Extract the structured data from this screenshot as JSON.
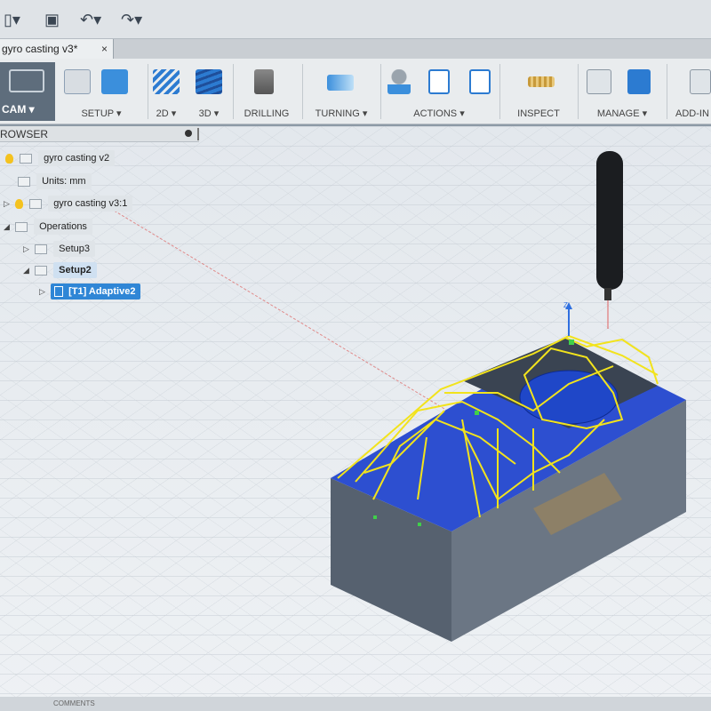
{
  "window": {
    "doc_tab": "gyro casting v3*",
    "tab_close": "×"
  },
  "quick_access": {
    "file_icon": "file-icon",
    "save_icon": "save-icon",
    "undo_icon": "undo-icon",
    "redo_icon": "redo-icon"
  },
  "ribbon": {
    "workspace": "CAM ▾",
    "groups": [
      {
        "label": "SETUP ▾"
      },
      {
        "label": "2D ▾"
      },
      {
        "label": "3D ▾"
      },
      {
        "label": "DRILLING"
      },
      {
        "label": "TURNING ▾"
      },
      {
        "label": "ACTIONS ▾"
      },
      {
        "label": "INSPECT"
      },
      {
        "label": "MANAGE ▾"
      },
      {
        "label": "ADD-IN"
      }
    ],
    "accent_colors": {
      "setup": "#3b8fdc",
      "blue_tool": "#2c7bd1",
      "drill": "#888",
      "turning": "#3b8fdc"
    }
  },
  "browser": {
    "title": "ROWSER",
    "items": [
      {
        "label": "gyro casting v2"
      },
      {
        "label": "Units: mm"
      },
      {
        "label": "gyro casting v3:1"
      },
      {
        "label": "Operations"
      },
      {
        "label": "Setup3"
      },
      {
        "label": "Setup2"
      },
      {
        "label": "[T1] Adaptive2"
      }
    ]
  },
  "viewport": {
    "axis_label": "Z",
    "colors": {
      "stock": "#5b6675",
      "toolpath": "#f0e020",
      "surface": "#1f47c8"
    }
  },
  "status": {
    "comments": "COMMENTS"
  }
}
